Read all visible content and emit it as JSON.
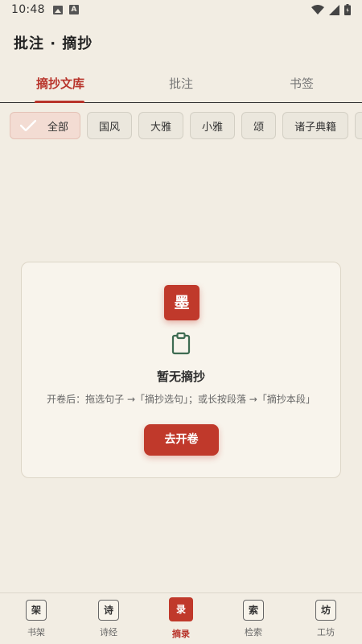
{
  "status_bar": {
    "time": "10:48"
  },
  "app": {
    "title": "批注 · 摘抄"
  },
  "tabs": [
    {
      "label": "摘抄文库",
      "active": true
    },
    {
      "label": "批注",
      "active": false
    },
    {
      "label": "书签",
      "active": false
    }
  ],
  "chips": [
    {
      "label": "全部",
      "selected": true
    },
    {
      "label": "国风",
      "selected": false
    },
    {
      "label": "大雅",
      "selected": false
    },
    {
      "label": "小雅",
      "selected": false
    },
    {
      "label": "颂",
      "selected": false
    },
    {
      "label": "诸子典籍",
      "selected": false
    },
    {
      "label": "",
      "selected": false
    }
  ],
  "empty_state": {
    "seal_char": "墨",
    "icon": "clipboard-icon",
    "title": "暂无摘抄",
    "hint": "开卷后：拖选句子 →「摘抄选句」；或长按段落 →「摘抄本段」",
    "button_label": "去开卷"
  },
  "bottom_nav": [
    {
      "badge": "架",
      "label": "书架",
      "active": false
    },
    {
      "badge": "诗",
      "label": "诗经",
      "active": false
    },
    {
      "badge": "录",
      "label": "摘录",
      "active": true
    },
    {
      "badge": "索",
      "label": "检索",
      "active": false
    },
    {
      "badge": "坊",
      "label": "工坊",
      "active": false
    }
  ],
  "colors": {
    "accent": "#c0392b",
    "background": "#f2ede3",
    "card": "#f8f4ec",
    "chip_selected": "#f3dcd3",
    "icon_green": "#3e6b52"
  }
}
